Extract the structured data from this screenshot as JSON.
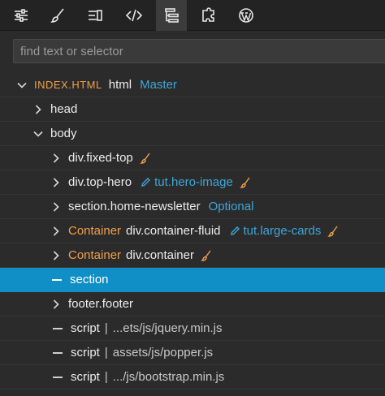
{
  "toolbar": {
    "tools": [
      {
        "icon": "sliders-icon"
      },
      {
        "icon": "brush-icon"
      },
      {
        "icon": "text-align-icon"
      },
      {
        "icon": "code-icon"
      },
      {
        "icon": "tree-icon",
        "active": true
      },
      {
        "icon": "puzzle-icon"
      },
      {
        "icon": "wordpress-icon"
      }
    ]
  },
  "search": {
    "placeholder": "find text or selector"
  },
  "tree": {
    "root": {
      "file": "INDEX.HTML",
      "tag": "html",
      "badge": "Master"
    },
    "head": "head",
    "body": "body",
    "fixed_top": "div.fixed-top",
    "top_hero": {
      "tag": "div.top-hero",
      "link": "tut.hero-image"
    },
    "newsletter": {
      "tag": "section.home-newsletter",
      "badge": "Optional"
    },
    "container_fluid": {
      "component": "Container",
      "tag": "div.container-fluid",
      "link": "tut.large-cards"
    },
    "container": {
      "component": "Container",
      "tag": "div.container"
    },
    "section": "section",
    "footer": "footer.footer",
    "script1": {
      "tag": "script",
      "path": "...ets/js/jquery.min.js"
    },
    "script2": {
      "tag": "script",
      "path": "assets/js/popper.js"
    },
    "script3": {
      "tag": "script",
      "path": ".../js/bootstrap.min.js"
    },
    "pipe": "|"
  },
  "colors": {
    "accent": "#0f8fc6",
    "component": "#f0a04a",
    "link": "#3ea6d8"
  }
}
